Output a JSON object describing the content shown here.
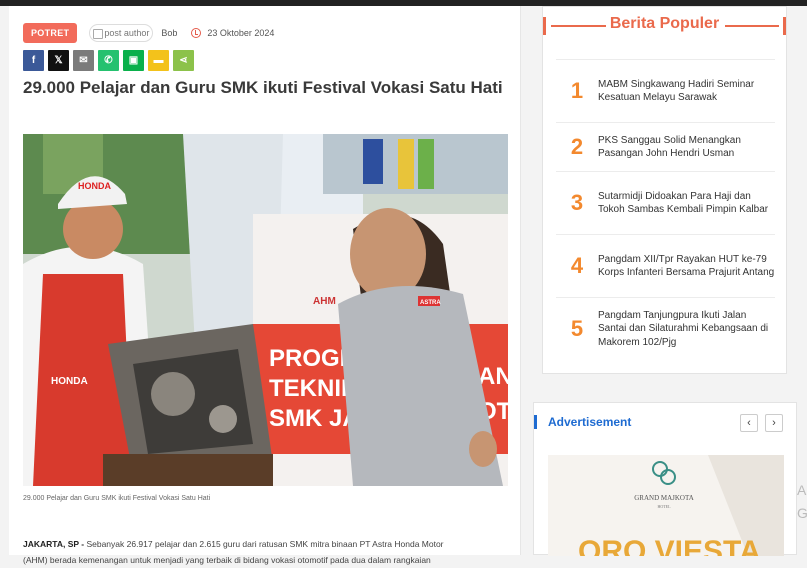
{
  "article": {
    "category": "POTRET",
    "author_img_alt": "post author",
    "author": "Bob",
    "date": "23 Oktober 2024",
    "share": [
      {
        "name": "facebook-share-icon",
        "glyph": "f",
        "color": "#3b5998"
      },
      {
        "name": "x-share-icon",
        "glyph": "𝕏",
        "color": "#111111"
      },
      {
        "name": "email-share-icon",
        "glyph": "✉",
        "color": "#7b7b7b"
      },
      {
        "name": "whatsapp-share-icon",
        "glyph": "✆",
        "color": "#25c16f"
      },
      {
        "name": "line-share-icon",
        "glyph": "▣",
        "color": "#0ab04b"
      },
      {
        "name": "sms-share-icon",
        "glyph": "▬",
        "color": "#f3c21b"
      },
      {
        "name": "sharethis-share-icon",
        "glyph": "⋖",
        "color": "#8cc24a"
      }
    ],
    "title": "29.000 Pelajar dan Guru SMK ikuti Festival Vokasi Satu Hati",
    "photo_texts": {
      "cap": "HONDA",
      "apron": "HONDA",
      "banner_1": "PROGRAM",
      "banner_2": "TEKNIK S",
      "banner_3": "SMK JAY",
      "banner_brand": "AHM",
      "banner_right": "AN",
      "banner_right2": "OT",
      "badge": "ASTRA"
    },
    "caption": "29.000 Pelajar dan Guru SMK ikuti Festival Vokasi Satu Hati",
    "lead_place": "JAKARTA, SP - ",
    "lead_text": "Sebanyak 26.917 pelajar dan 2.615 guru dari ratusan SMK mitra binaan PT Astra Honda Motor",
    "lead_text_2": "(AHM) berada kemenangan untuk menjadi yang terbaik di bidang vokasi otomotif pada dua dalam rangkaian"
  },
  "popular": {
    "heading": "Berita Populer",
    "accent": "#ea6a4c",
    "items": [
      {
        "num": "1",
        "title": "MABM Singkawang Hadiri Seminar Kesatuan Melayu Sarawak"
      },
      {
        "num": "2",
        "title": "PKS Sanggau Solid Menangkan Pasangan John Hendri Usman"
      },
      {
        "num": "3",
        "title": "Sutarmidji Didoakan Para Haji dan Tokoh Sambas Kembali Pimpin Kalbar"
      },
      {
        "num": "4",
        "title": "Pangdam XII/Tpr Rayakan HUT ke-79 Korps Infanteri Bersama Prajurit Antang"
      },
      {
        "num": "5",
        "title": "Pangdam Tanjungpura Ikuti Jalan Santai dan Silaturahmi Kebangsaan di Makorem 102/Pjg"
      }
    ]
  },
  "ad": {
    "heading": "Advertisement",
    "prev": "‹",
    "next": "›",
    "brand": "GRAND MAJKOTA",
    "brand_sub": "HOTEL",
    "promo": "ORO VIESTA"
  },
  "edge": [
    "A",
    "G"
  ]
}
